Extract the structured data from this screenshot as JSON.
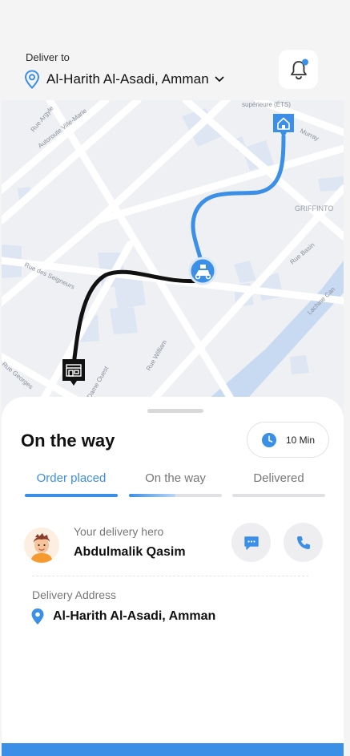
{
  "header": {
    "deliver_label": "Deliver to",
    "location": "Al-Harith Al-Asadi, Amman",
    "notification_badge_color": "#3b8fe6"
  },
  "map": {
    "street_labels": [
      "Rue Argyle",
      "Autoroute Ville-Marie",
      "supérieure (ÉTS)",
      "Murray",
      "GRIFFINTO",
      "Rue Basin",
      "Lachine Can",
      "Rue des Seigneurs",
      "Rue William",
      "Notre-Dame Ouest",
      "Rue Georges"
    ],
    "route_colors": {
      "traveled": "#111111",
      "remaining": "#3b8fe6"
    },
    "markers": [
      "store-icon",
      "scooter-icon",
      "home-icon"
    ]
  },
  "status": {
    "title": "On the way",
    "eta": "10 Min",
    "tabs": [
      {
        "label": "Order placed",
        "progress": 1.0,
        "active": true
      },
      {
        "label": "On the way",
        "progress": 0.5,
        "active": false
      },
      {
        "label": "Delivered",
        "progress": 0.0,
        "active": false
      }
    ]
  },
  "hero": {
    "label": "Your delivery hero",
    "name": "Abdulmalik Qasim"
  },
  "address": {
    "label": "Delivery Address",
    "value": "Al-Harith Al-Asadi, Amman"
  },
  "theme": {
    "accent": "#3b8fe6"
  }
}
